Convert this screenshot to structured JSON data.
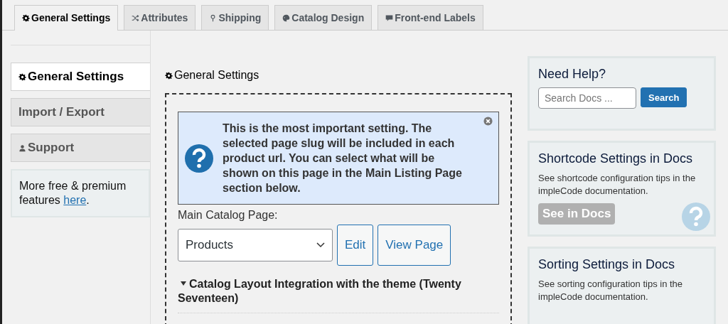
{
  "tabs": [
    {
      "label": "General Settings",
      "selected": true
    },
    {
      "label": "Attributes",
      "selected": false
    },
    {
      "label": "Shipping",
      "selected": false
    },
    {
      "label": "Catalog Design",
      "selected": false
    },
    {
      "label": "Front-end Labels",
      "selected": false
    }
  ],
  "sidebar": {
    "items": [
      {
        "label": "General Settings",
        "selected": true
      },
      {
        "label": "Import / Export",
        "selected": false
      },
      {
        "label": "Support",
        "selected": false
      }
    ],
    "promo": {
      "text": "More free & premium features ",
      "link": "here",
      "after": "."
    }
  },
  "main": {
    "heading": "General Settings",
    "notice": "This is the most important setting. The selected page slug will be included in each product url. You can select what will be shown on this page in the Main Listing Page section below.",
    "field_label": "Main Catalog Page:",
    "select_value": "Products",
    "buttons": [
      "Edit",
      "View Page"
    ],
    "section": "Catalog Layout Integration with the theme (Twenty Seventeen)"
  },
  "help": {
    "title": "Need Help?",
    "search_placeholder": "Search Docs ...",
    "search_button": "Search"
  },
  "doc_cards": [
    {
      "title": "Shortcode Settings in Docs",
      "text": "See shortcode configuration tips in the impleCode documentation.",
      "button": "See in Docs"
    },
    {
      "title": "Sorting Settings in Docs",
      "text": "See sorting configuration tips in the impleCode documentation."
    }
  ]
}
